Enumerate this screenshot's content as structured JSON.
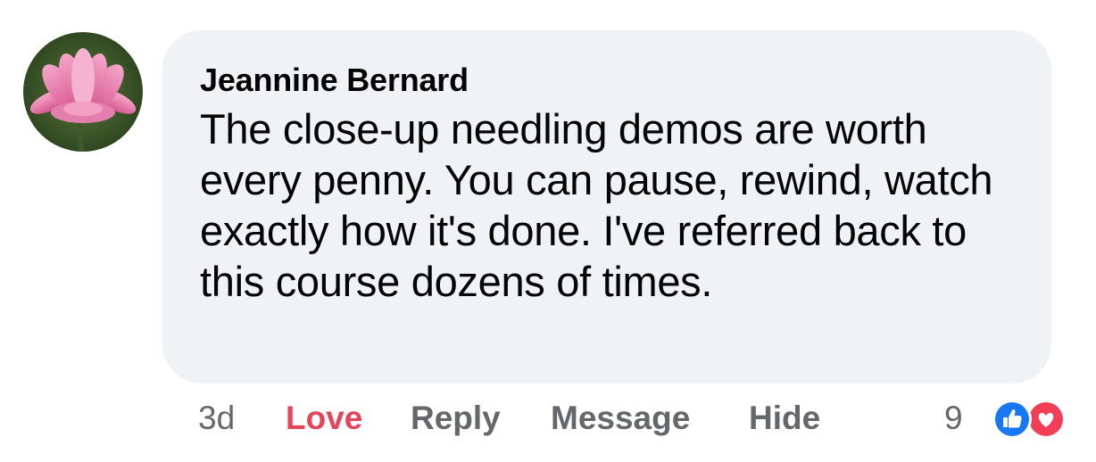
{
  "comment": {
    "author": "Jeannine Bernard",
    "text": "The close-up needling demos are worth every penny. You can pause, rewind, watch exactly how it's done. I've referred back to this course dozens of times."
  },
  "actions": {
    "time": "3d",
    "love": "Love",
    "reply": "Reply",
    "message": "Message",
    "hide": "Hide"
  },
  "reactions": {
    "count": "9",
    "icons": [
      "like-icon",
      "love-icon"
    ],
    "like_color": "#1877f2",
    "love_color": "#f33e58"
  },
  "avatar": {
    "icon": "lotus-flower-avatar"
  }
}
